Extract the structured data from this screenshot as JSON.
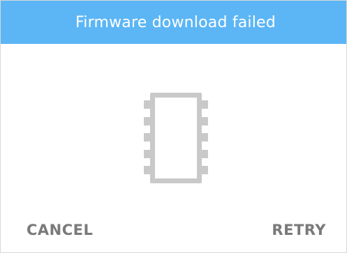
{
  "dialog": {
    "title": "Firmware download failed",
    "icon": "chip-icon",
    "accent_color": "#5cb6f5",
    "icon_color": "#c9c9c9",
    "button_color": "#7a7a7a"
  },
  "buttons": {
    "cancel_label": "CANCEL",
    "retry_label": "RETRY"
  }
}
